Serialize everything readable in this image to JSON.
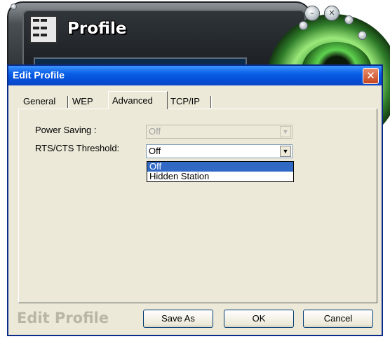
{
  "background_app": {
    "title": "Profile",
    "buttons": [
      "minimize",
      "close"
    ]
  },
  "dialog": {
    "title": "Edit Profile",
    "close_glyph": "✕",
    "tabs": [
      {
        "label": "General",
        "active": false
      },
      {
        "label": "WEP",
        "active": false
      },
      {
        "label": "Advanced",
        "active": true
      },
      {
        "label": "TCP/IP",
        "active": false
      }
    ],
    "fields": {
      "power_saving": {
        "label": "Power Saving :",
        "value": "Off",
        "enabled": false
      },
      "rts_cts": {
        "label": "RTS/CTS Threshold:",
        "value": "Off",
        "enabled": true,
        "options": [
          "Off",
          "Hidden Station"
        ],
        "highlighted_option": "Off"
      }
    },
    "footer": {
      "logo_text": "Edit Profile",
      "save_as": "Save As",
      "ok": "OK",
      "cancel": "Cancel"
    }
  },
  "colors": {
    "titlebar": "#0a5ee6",
    "dialog_bg": "#ece9d8",
    "selection": "#316ac5",
    "accent_green": "#3fa03a"
  }
}
